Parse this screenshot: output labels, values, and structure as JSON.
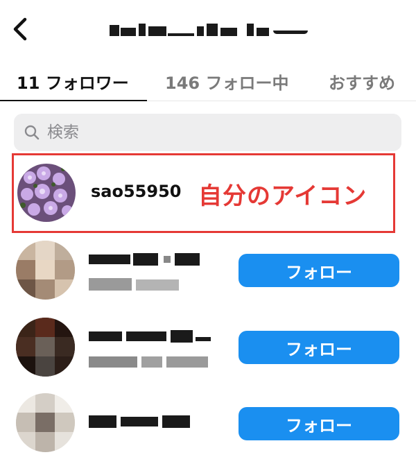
{
  "header": {
    "back_icon": "chevron-left-icon"
  },
  "tabs": [
    {
      "label": "11 フォロワー",
      "active": true
    },
    {
      "label": "146 フォロー中",
      "active": false
    },
    {
      "label": "おすすめ",
      "active": false
    }
  ],
  "search": {
    "placeholder": "検索",
    "icon": "search-icon"
  },
  "highlight": {
    "username": "sao55950",
    "annotation": "自分のアイコン",
    "border_color": "#e53935"
  },
  "followers": [
    {
      "button_label": "フォロー"
    },
    {
      "button_label": "フォロー"
    },
    {
      "button_label": "フォロー"
    }
  ],
  "colors": {
    "accent": "#1a8ff0",
    "annotation": "#e53935"
  }
}
